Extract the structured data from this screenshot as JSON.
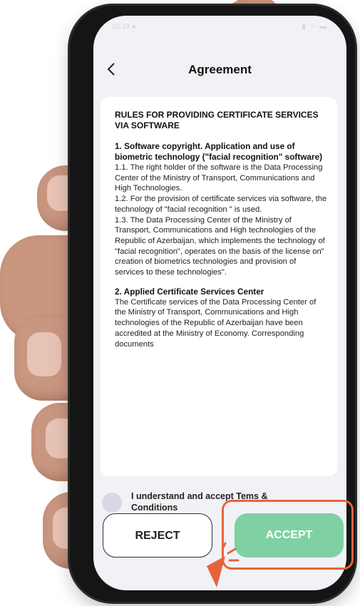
{
  "status": {
    "time": "10:19 ●",
    "icons": "▮ ≈ ▬"
  },
  "nav": {
    "back_icon": "chevron-left-icon",
    "title": "Agreement"
  },
  "agreement": {
    "heading": "RULES FOR PROVIDING CERTIFICATE SERVICES VIA SOFTWARE",
    "section1_title": "1. Software copyright. Application and use of biometric technology (\"facial recognition\" software)",
    "p1_1": "1.1. The right holder of the software is the Data Processing Center of the Ministry of Transport, Communications and High Technologies.",
    "p1_2": "1.2. For the provision of certificate services via software, the technology of \"facial recognition \" is used.",
    "p1_3": "1.3. The Data Processing Center of the Ministry of Transport, Communications and High technologies of the Republic of Azerbaijan, which implements the technology of \"facial recognition\", operates on the basis of the license on\" creation of biometrics technologies and provision of services to these technologies\".",
    "section2_title": "2. Applied Certificate Services Center",
    "p2_1": "The Certificate services of the Data Processing Center of the Ministry of Transport, Communications and High technologies of the Republic of Azerbaijan have been accredited at the Ministry of Economy. Corresponding documents"
  },
  "consent": {
    "label": "I understand and accept Tems & Conditions"
  },
  "buttons": {
    "reject": "REJECT",
    "accept": "ACCEPT"
  },
  "colors": {
    "accent": "#7fd1a3",
    "highlight": "#e8633b",
    "checkbox": "#d8d8e2"
  }
}
